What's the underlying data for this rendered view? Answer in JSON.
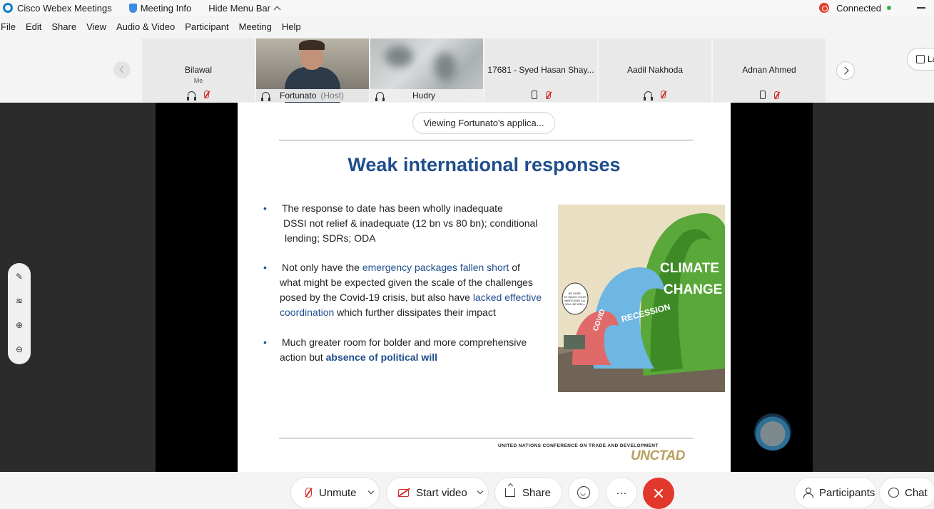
{
  "window": {
    "app_title": "Cisco Webex Meetings",
    "meeting_info": "Meeting Info",
    "hide_menu": "Hide Menu Bar",
    "status": "Connected"
  },
  "menu": [
    "File",
    "Edit",
    "Share",
    "View",
    "Audio & Video",
    "Participant",
    "Meeting",
    "Help"
  ],
  "participants": [
    {
      "name": "Bilawal",
      "sub": "Me"
    },
    {
      "name": "Fortunato",
      "sub": "(Host)"
    },
    {
      "name": "Hudry",
      "sub": ""
    },
    {
      "name": "17681 - Syed Hasan Shay...",
      "sub": ""
    },
    {
      "name": "Aadil Nakhoda",
      "sub": ""
    },
    {
      "name": "Adnan Ahmed",
      "sub": ""
    }
  ],
  "layout_label": "La",
  "share": {
    "viewing": "Viewing Fortunato's applica...",
    "slide": {
      "title": "Weak international responses",
      "bullet_marker": "•",
      "b1_l1": "The response to date has been wholly inadequate",
      "b1_l2": "DSSI not relief & inadequate (12 bn vs 80 bn); conditional",
      "b1_l3": "lending; SDRs; ODA",
      "b2_a": "Not only have the ",
      "b2_hl1": "emergency packages fallen short",
      "b2_b": " of",
      "b2_l2": "what might be expected given the scale of the challenges",
      "b2_l3a": "posed by the Covid-19 crisis, but also have ",
      "b2_hl2": "lacked effective",
      "b2_hl3": "coordination",
      "b2_l4b": " which further dissipates their impact",
      "b3_l1": "Much greater room for bolder and more comprehensive",
      "b3_l2a": "action but ",
      "b3_hl": "absence of political will",
      "cartoon_text": {
        "wave1": "COVID",
        "wave2": "RECESSION",
        "wave3a": "CLIMATE",
        "wave3b": "CHANGE",
        "bubble": "BE SURE TO WASH YOUR HANDS AND ALL WILL BE WELL"
      },
      "footer_small": "UNITED NATIONS CONFERENCE ON TRADE AND DEVELOPMENT",
      "footer_logo": "UNCTAD"
    }
  },
  "controls": {
    "unmute": "Unmute",
    "start_video": "Start video",
    "share": "Share",
    "more": "···",
    "participants": "Participants",
    "chat": "Chat"
  },
  "colors": {
    "title_blue": "#1f4e8c",
    "leave_red": "#e2382b",
    "mute_red": "#d0312d"
  }
}
